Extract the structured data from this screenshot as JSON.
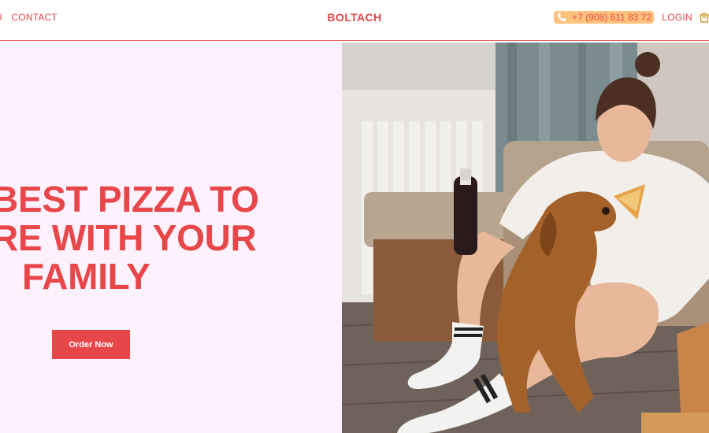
{
  "nav": {
    "menu_label": "U",
    "contact_label": "CONTACT",
    "brand": "BOLTACH",
    "phone": "+7 (908) 611 83 72",
    "login_label": "LOGIN"
  },
  "hero": {
    "headline_line1": "BEST PIZZA TO",
    "headline_line2": "RE WITH YOUR",
    "headline_line3": "FAMILY",
    "cta_label": "Order Now"
  },
  "icons": {
    "phone": "phone-icon",
    "cart": "cart-icon"
  },
  "colors": {
    "accent": "#e8474a",
    "phone_pill": "#ffc27a",
    "hero_bg": "#fdf1fe"
  }
}
